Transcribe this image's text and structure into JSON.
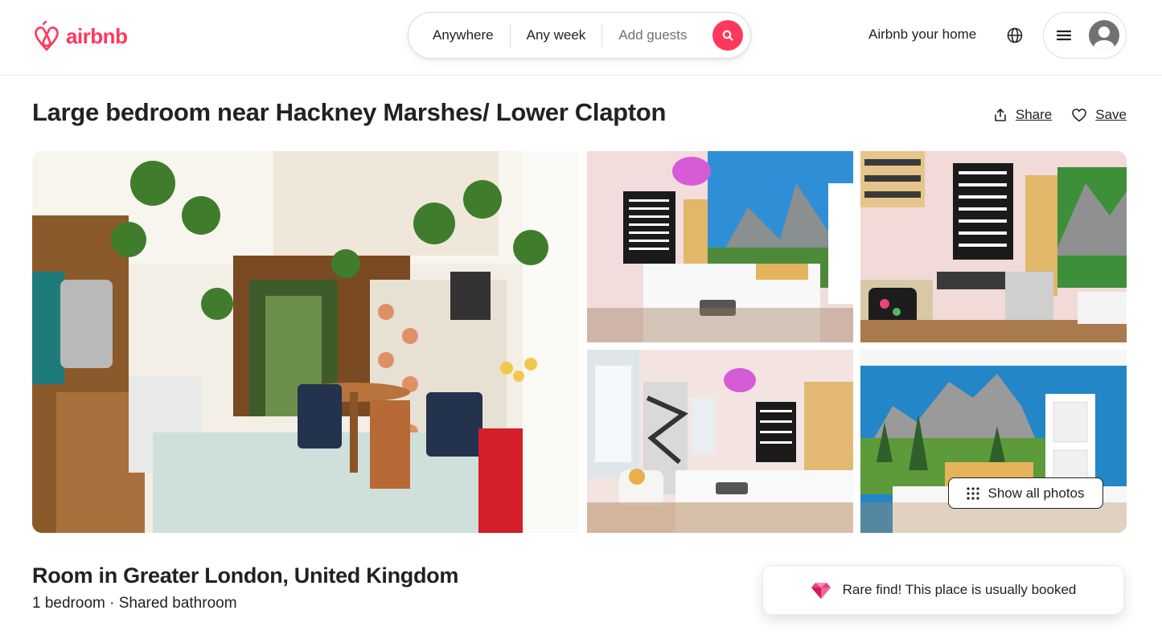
{
  "header": {
    "brand": "airbnb",
    "search": {
      "location": "Anywhere",
      "dates": "Any week",
      "guests": "Add guests"
    },
    "host_link": "Airbnb your home",
    "icons": {
      "logo": "airbnb-logo-icon",
      "search": "search-icon",
      "globe": "globe-icon",
      "menu": "hamburger-menu-icon",
      "avatar": "user-avatar-icon"
    }
  },
  "listing": {
    "title": "Large bedroom near Hackney Marshes/ Lower Clapton",
    "actions": {
      "share": "Share",
      "save": "Save"
    },
    "gallery": {
      "photos": [
        "Kitchen and dining room with plants opening to garden",
        "Bedroom with mountain mural and poster",
        "Desk area with bookshelves",
        "Bedroom with bay window",
        "Mountain landscape wall mural"
      ],
      "show_all": "Show all photos"
    },
    "room_title": "Room in Greater London, United Kingdom",
    "room_details": "1 bedroom · Shared bathroom",
    "rare_find": "Rare find! This place is usually booked"
  },
  "colors": {
    "brand": "#ff385c",
    "text": "#222222",
    "muted": "#717171",
    "border": "#dddddd"
  }
}
